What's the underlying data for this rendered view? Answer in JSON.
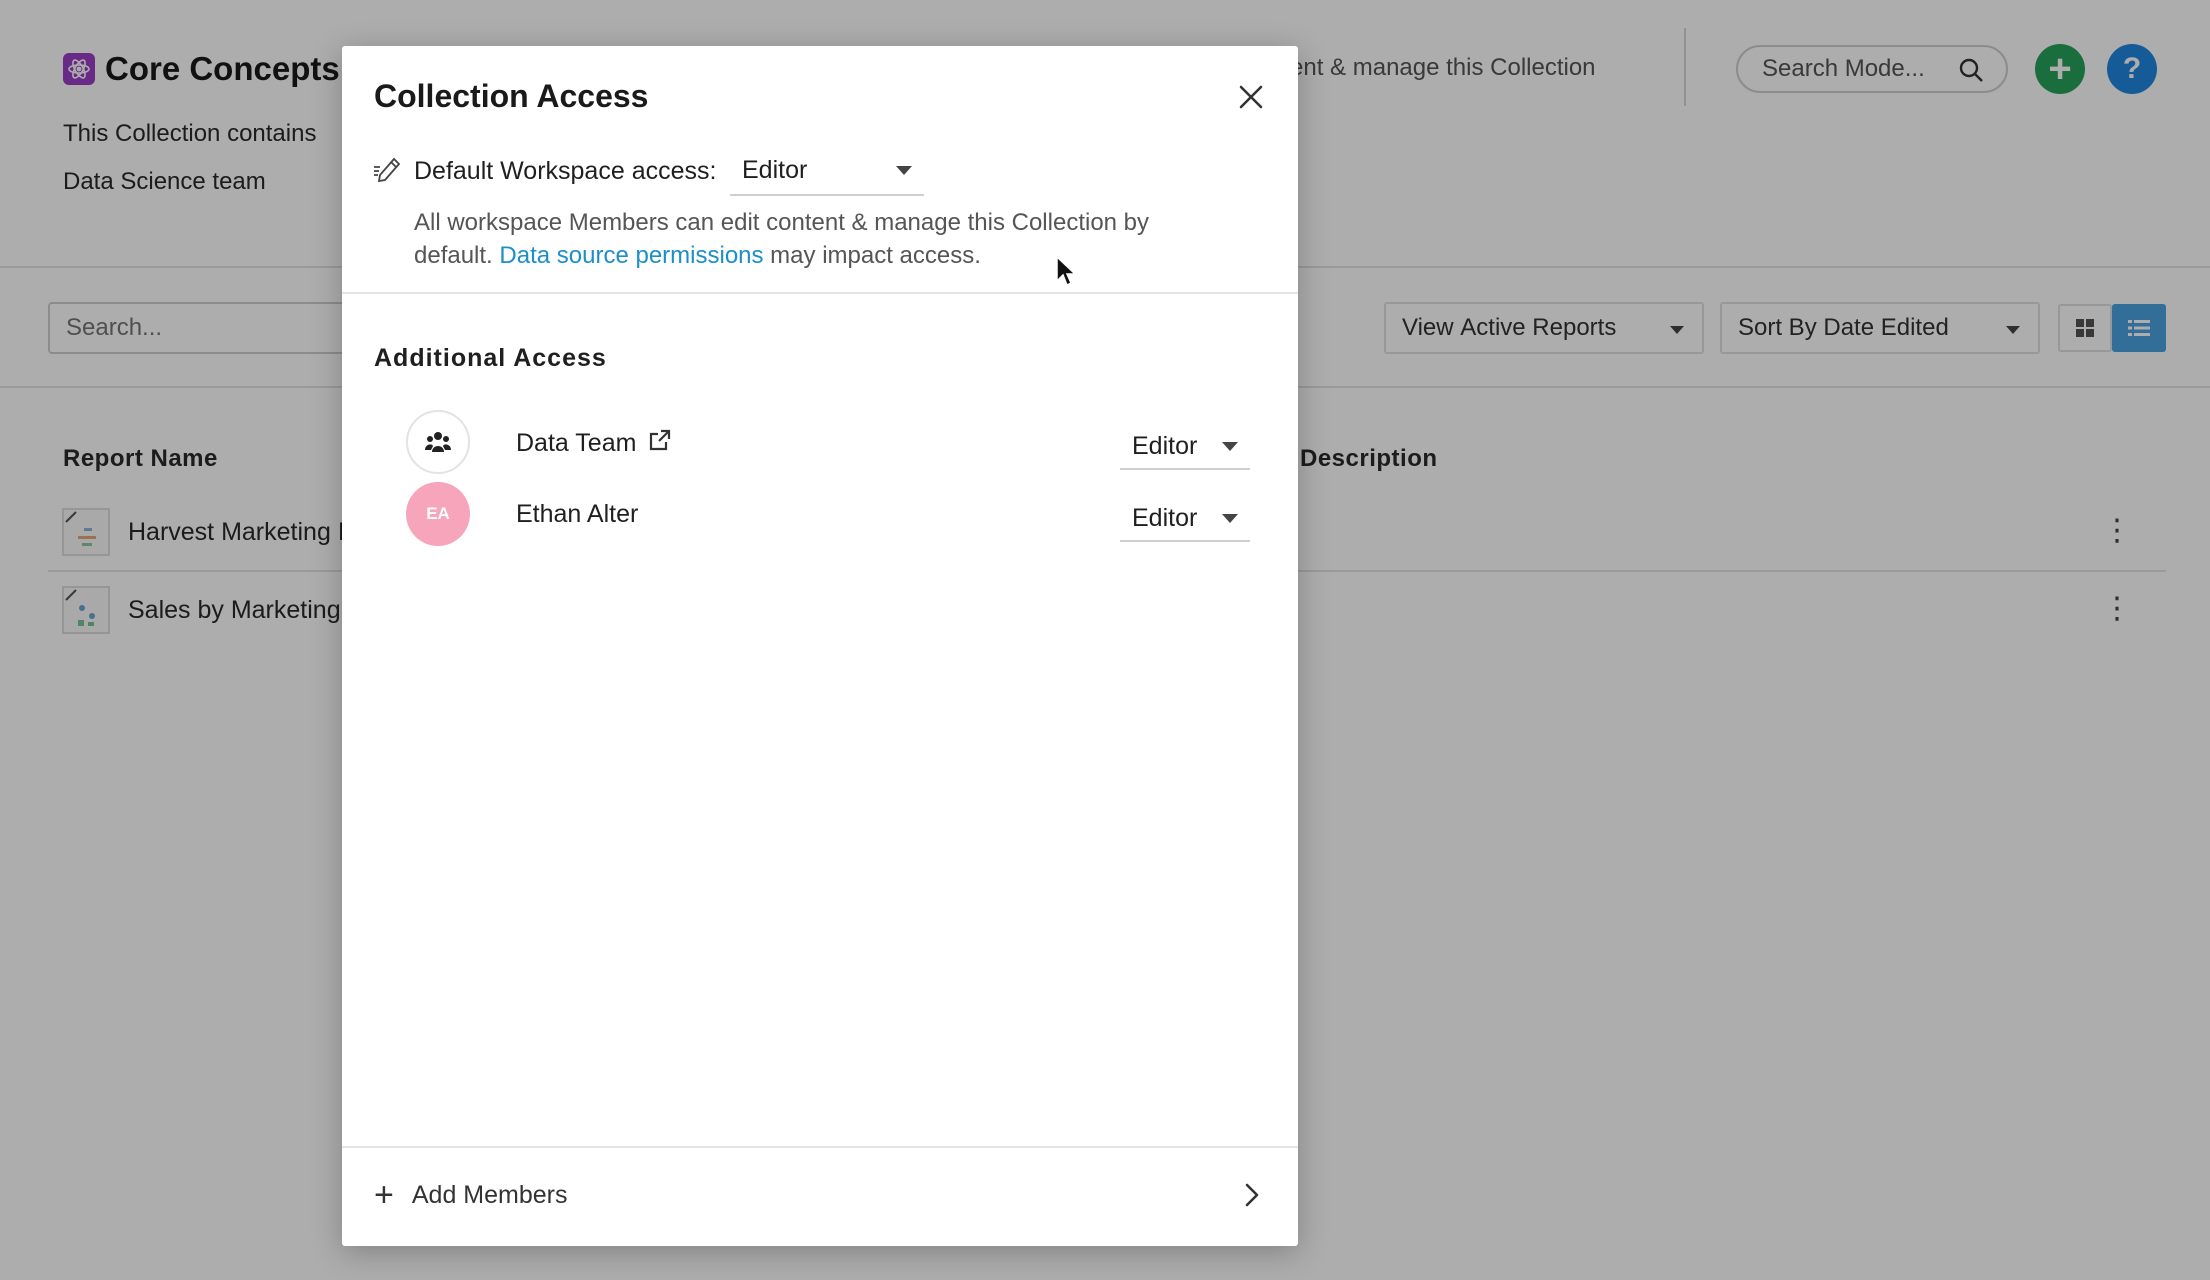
{
  "page": {
    "title": "Core Concepts",
    "description_line1": "This Collection contains",
    "description_line2": "Data Science team",
    "description_right": "ntent & manage this Collection",
    "search_models_placeholder": "Search Mode...",
    "add_button": "+",
    "help_button": "?"
  },
  "toolbar": {
    "search_placeholder": "Search...",
    "view_select": {
      "label": "View",
      "value": "Active Reports"
    },
    "sort_select": {
      "label": "Sort By",
      "value": "Date Edited"
    }
  },
  "table": {
    "columns": [
      "Report Name",
      "Description"
    ],
    "rows": [
      {
        "name": "Harvest Marketing I"
      },
      {
        "name": "Sales by Marketing"
      }
    ]
  },
  "modal": {
    "title": "Collection Access",
    "default_access_label": "Default Workspace access:",
    "default_access_value": "Editor",
    "info_text_before": "All workspace Members can edit content & manage this Collection by default. ",
    "info_link": "Data source permissions",
    "info_text_after": " may impact access.",
    "additional_access_title": "Additional Access",
    "members": [
      {
        "name": "Data Team",
        "initials": "",
        "role": "Editor"
      },
      {
        "name": "Ethan Alter",
        "initials": "EA",
        "role": "Editor"
      }
    ],
    "add_members_label": "Add Members"
  },
  "colors": {
    "accent_link": "#1a8fc9",
    "add_button": "#27a35a",
    "help_button": "#1f86e0",
    "avatar_ea": "#f7a5ba",
    "collection_icon": "#9b3fc8",
    "list_toggle_active": "#4aa3df"
  }
}
